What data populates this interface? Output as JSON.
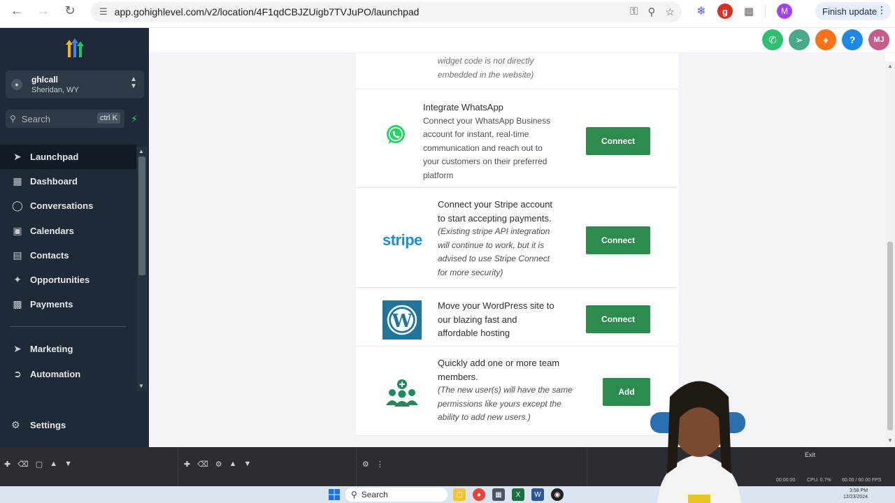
{
  "browser": {
    "url": "app.gohighlevel.com/v2/location/4F1qdCBJZUigb7TVJuPO/launchpad",
    "finish_update_label": "Finish update",
    "profile_initial": "M"
  },
  "sidebar": {
    "account_name": "ghlcall",
    "account_location": "Sheridan, WY",
    "search_placeholder": "Search",
    "search_shortcut": "ctrl K",
    "items": [
      {
        "label": "Launchpad",
        "icon": "rocket-icon"
      },
      {
        "label": "Dashboard",
        "icon": "grid-icon"
      },
      {
        "label": "Conversations",
        "icon": "chat-icon"
      },
      {
        "label": "Calendars",
        "icon": "calendar-icon"
      },
      {
        "label": "Contacts",
        "icon": "contacts-icon"
      },
      {
        "label": "Opportunities",
        "icon": "opportunities-icon"
      },
      {
        "label": "Payments",
        "icon": "payments-icon"
      }
    ],
    "items2": [
      {
        "label": "Marketing",
        "icon": "send-icon"
      },
      {
        "label": "Automation",
        "icon": "automation-icon"
      }
    ],
    "settings_label": "Settings"
  },
  "topbar": {
    "avatar_initials": "MJ",
    "help_label": "?"
  },
  "cards": {
    "widget_tail_1": "widget code is not directly",
    "widget_tail_2": "embedded in the website)",
    "whatsapp_title": "Integrate WhatsApp",
    "whatsapp_desc_1": "Connect your WhatsApp Business",
    "whatsapp_desc_2": "account for instant, real-time",
    "whatsapp_desc_3": "communication and reach out to",
    "whatsapp_desc_4": "your customers on their preferred",
    "whatsapp_desc_5": "platform",
    "whatsapp_button": "Connect",
    "stripe_logo": "stripe",
    "stripe_desc_1": "Connect your Stripe account",
    "stripe_desc_2": "to start accepting payments.",
    "stripe_note_1": "(Existing stripe API integration",
    "stripe_note_2": "will continue to work, but it is",
    "stripe_note_3": "advised to use Stripe Connect",
    "stripe_note_4": "for more security)",
    "stripe_button": "Connect",
    "wp_desc_1": "Move your WordPress site to",
    "wp_desc_2": "our blazing fast and",
    "wp_desc_3": "affordable hosting",
    "wp_button": "Connect",
    "team_desc_1": "Quickly add one or more team",
    "team_desc_2": "members.",
    "team_note_1": "(The new user(s) will have the same",
    "team_note_2": "permissions like yours except the",
    "team_note_3": "ability to add new users.)",
    "team_button": "Add"
  },
  "obs": {
    "exit_label": "Exit",
    "cpu": "CPU: 0.7%",
    "fps": "60.00 / 60.00 FPS",
    "time_code": "00:00:00"
  },
  "taskbar": {
    "search_label": "Search",
    "time": "3:58 PM",
    "date": "12/23/2024"
  },
  "colors": {
    "sidebar_bg": "#1e2a38",
    "connect_green": "#2e8b4e",
    "whatsapp_green": "#25d366",
    "stripe_blue": "#1a8fd6",
    "wp_blue": "#21759b",
    "team_green": "#1f8a5c"
  }
}
